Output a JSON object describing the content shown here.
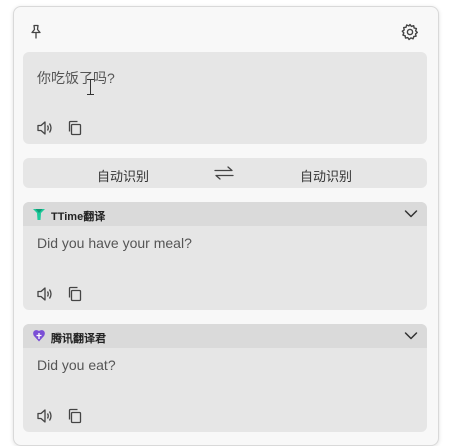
{
  "source": {
    "text": "你吃饭了吗?"
  },
  "languages": {
    "from": "自动识别",
    "to": "自动识别"
  },
  "results": [
    {
      "engine": "TTime翻译",
      "text": "Did you have your meal?",
      "logo_color": "#1ec99a"
    },
    {
      "engine": "腾讯翻译君",
      "text": "Did you eat?",
      "logo_color": "#7b4fd6"
    }
  ],
  "icons": {
    "pin": "pin-icon",
    "settings": "gear-icon",
    "speaker": "speaker-icon",
    "copy": "copy-icon",
    "swap": "swap-icon",
    "expand": "chevron-down-icon"
  }
}
